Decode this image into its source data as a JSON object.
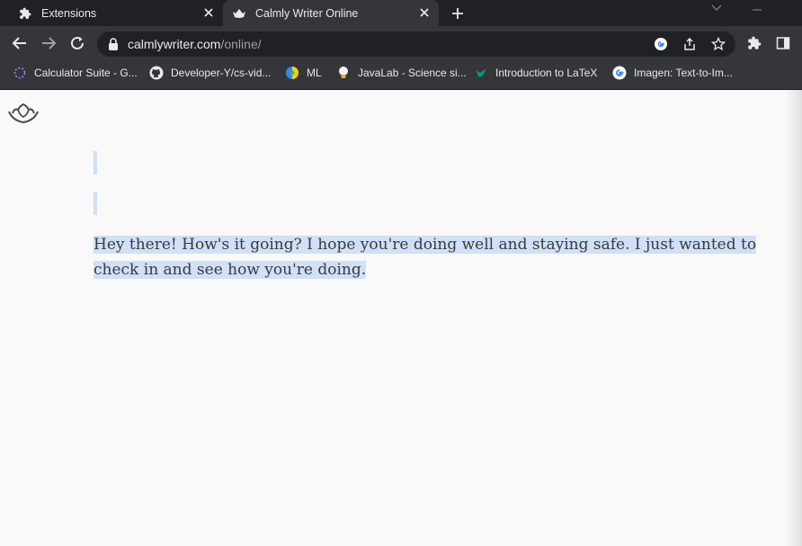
{
  "tabs": [
    {
      "title": "Extensions",
      "icon": "puzzle-icon",
      "active": false
    },
    {
      "title": "Calmly Writer Online",
      "icon": "lotus-icon",
      "active": true
    }
  ],
  "address_bar": {
    "domain": "calmlywriter.com",
    "path": "/online/"
  },
  "bookmarks": [
    {
      "label": "Calculator Suite - G...",
      "icon": "dotted-circle-icon"
    },
    {
      "label": "Developer-Y/cs-vid...",
      "icon": "github-icon"
    },
    {
      "label": "ML",
      "icon": "colorful-orb-icon"
    },
    {
      "label": "JavaLab - Science si...",
      "icon": "lightbulb-icon"
    },
    {
      "label": "Introduction to LaTeX",
      "icon": "bird-icon"
    },
    {
      "label": "Imagen: Text-to-Im...",
      "icon": "google-icon"
    }
  ],
  "editor": {
    "text": "Hey there! How's it going? I hope you're doing well and staying safe. I just wanted to check in and see how you're doing."
  },
  "colors": {
    "tab_bg": "#202124",
    "toolbar_bg": "#35363a",
    "selection": "#cfe0f7",
    "page_bg": "#f9f9fa"
  }
}
